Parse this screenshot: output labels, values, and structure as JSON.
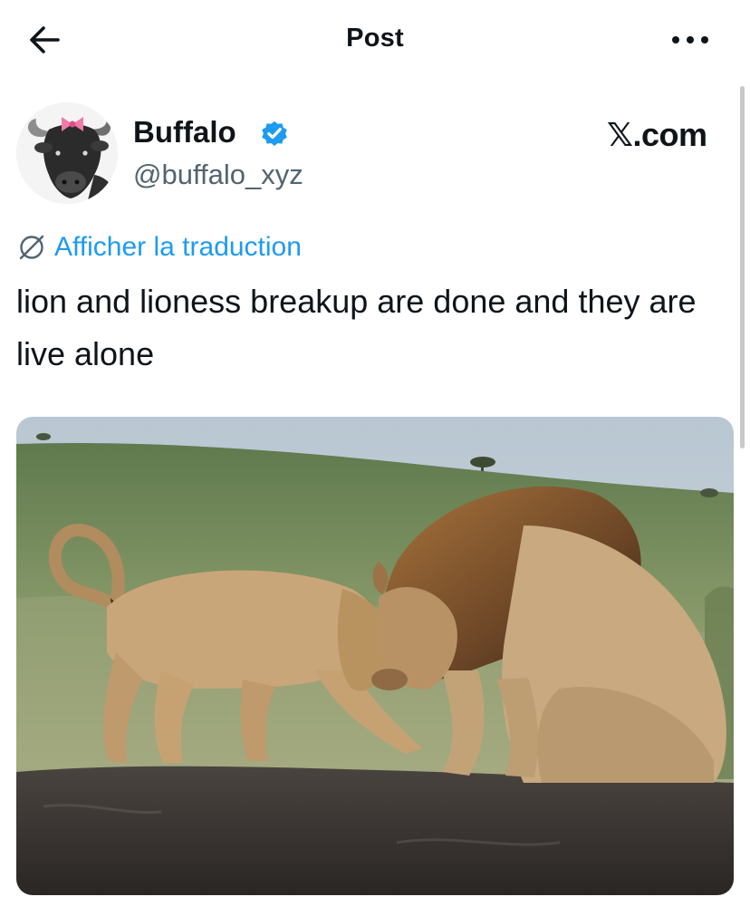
{
  "header": {
    "title": "Post",
    "back_icon": "arrow-left-icon",
    "more_icon": "more-horizontal-icon"
  },
  "author": {
    "name": "Buffalo",
    "handle": "@buffalo_xyz",
    "verified": true,
    "verified_color": "#1d9bf0",
    "source_label": "𝕏.com"
  },
  "translate": {
    "label": "Afficher la traduction",
    "icon": "translate-icon",
    "color": "#1d9bf0"
  },
  "tweet": {
    "text": "lion and lioness breakup are done and they are live alone"
  },
  "media": {
    "alt": "A lion and a lioness touching heads on a rock in the savanna"
  }
}
